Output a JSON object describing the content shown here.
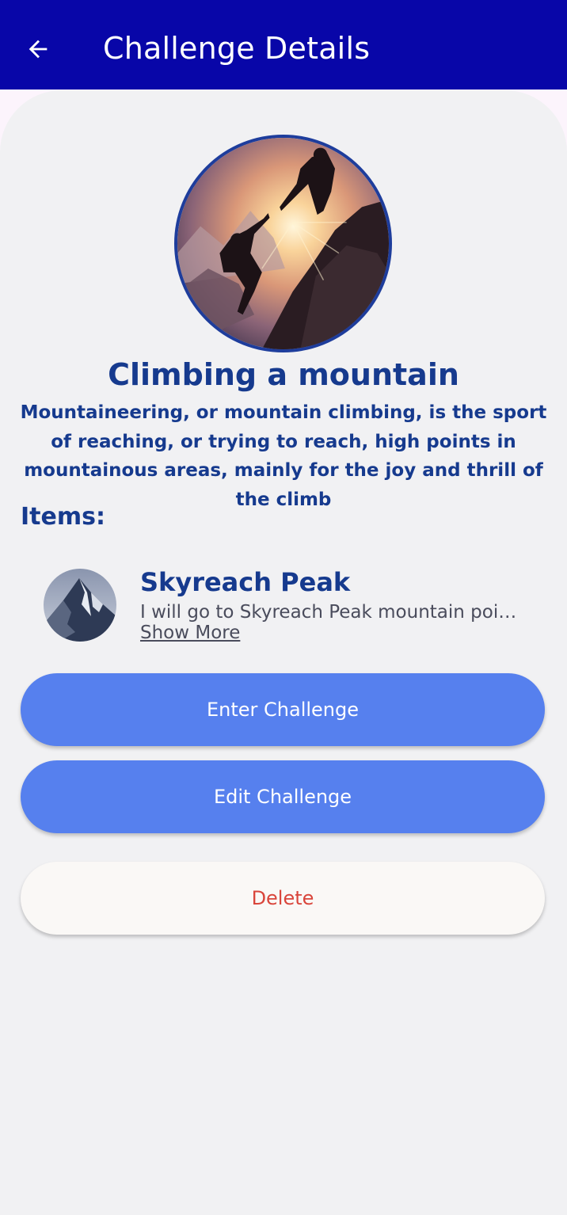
{
  "app_bar": {
    "title": "Challenge Details",
    "back_icon": "arrow-left-icon",
    "background_color": "#0806a8"
  },
  "challenge": {
    "image": "mountain-climbers-photo",
    "title": "Climbing a mountain",
    "description": "Mountaineering, or mountain climbing, is the sport of reaching, or trying to reach, high points in mountainous areas, mainly for the joy and thrill of the climb"
  },
  "items_section": {
    "heading": "Items:",
    "items": [
      {
        "image": "mountain-peak-photo",
        "name": "Skyreach Peak",
        "description": "I will go to Skyreach Peak mountain point and climb it",
        "show_more_label": "Show More"
      }
    ]
  },
  "actions": {
    "enter_label": "Enter Challenge",
    "edit_label": "Edit Challenge",
    "delete_label": "Delete"
  },
  "colors": {
    "primary_text": "#163a8e",
    "button_blue": "#5680ee",
    "delete_red": "#d9453b"
  }
}
